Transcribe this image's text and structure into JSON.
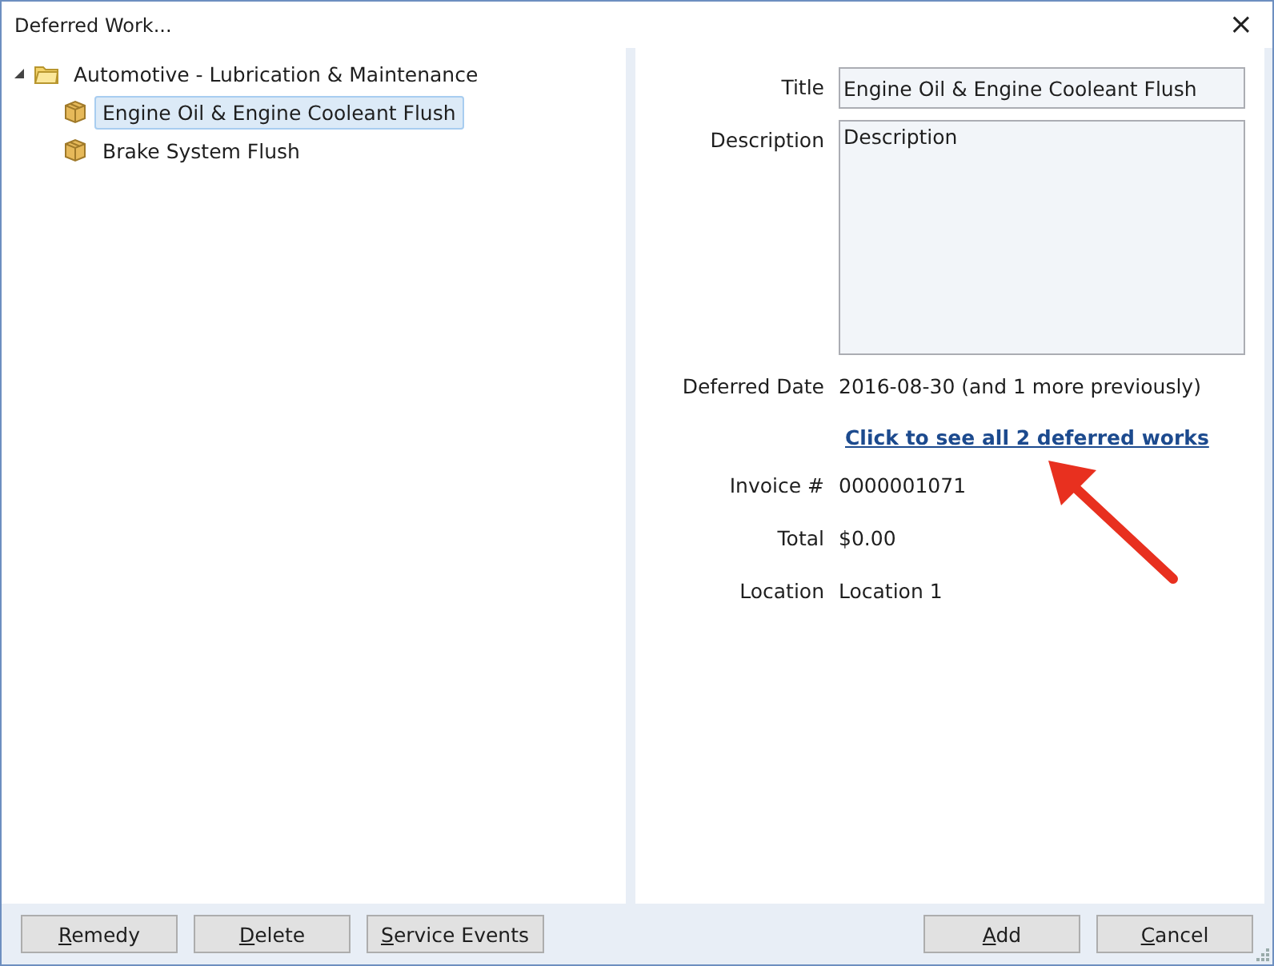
{
  "window": {
    "title": "Deferred Work...",
    "close": "×"
  },
  "tree": [
    {
      "label": "Automotive - Lubrication & Maintenance",
      "kind": "folder",
      "expanded": true,
      "selected": false,
      "children": [
        {
          "label": "Engine Oil & Engine Cooleant Flush",
          "kind": "item",
          "selected": true
        },
        {
          "label": "Brake System Flush",
          "kind": "item",
          "selected": false
        }
      ]
    }
  ],
  "form": {
    "title": {
      "label": "Title",
      "value": "Engine Oil & Engine Cooleant Flush"
    },
    "description": {
      "label": "Description",
      "placeholder": "Description"
    },
    "deferred_date": {
      "label": "Deferred Date",
      "value": "2016-08-30 (and 1 more previously)"
    },
    "link": "Click to see all 2 deferred works",
    "rows": [
      {
        "label": "Invoice #",
        "value": "0000001071"
      },
      {
        "label": "Total",
        "value": "$0.00"
      },
      {
        "label": "Location",
        "value": "Location 1"
      }
    ]
  },
  "buttons_left": [
    "Remedy",
    "Delete",
    "Service Events"
  ],
  "buttons_right": [
    "Add",
    "Cancel"
  ]
}
